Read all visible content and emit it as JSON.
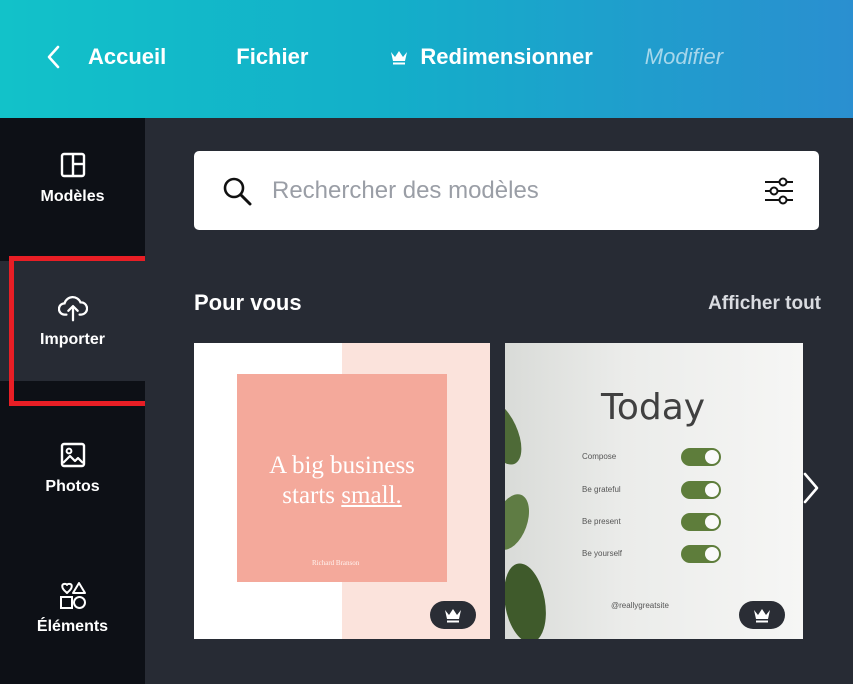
{
  "topbar": {
    "back_label": "Accueil",
    "file_label": "Fichier",
    "resize_label": "Redimensionner",
    "edit_label": "Modifier"
  },
  "rail": {
    "items": [
      {
        "label": "Modèles",
        "icon": "layout-icon"
      },
      {
        "label": "Importer",
        "icon": "cloud-upload-icon"
      },
      {
        "label": "Photos",
        "icon": "image-icon"
      },
      {
        "label": "Éléments",
        "icon": "shapes-icon"
      }
    ],
    "highlight_color": "#e81e25"
  },
  "search": {
    "placeholder": "Rechercher des modèles",
    "icon": "search-icon",
    "filter_icon": "sliders-icon"
  },
  "section": {
    "title": "Pour vous",
    "see_all": "Afficher tout"
  },
  "cards": [
    {
      "quote_line1": "A big business",
      "quote_line2_pre": "starts ",
      "quote_line2_u": "small.",
      "author": "Richard Branson",
      "badge": "crown-icon",
      "colors": {
        "pink": "#f4a99b",
        "tint": "#fbe3dc"
      }
    },
    {
      "title": "Today",
      "items": [
        "Compose",
        "Be grateful",
        "Be present",
        "Be yourself"
      ],
      "handle": "@reallygreatsite",
      "badge": "crown-icon",
      "toggle_color": "#5e7d3b"
    }
  ],
  "colors": {
    "topbar_start": "#12c2c9",
    "topbar_end": "#2a8fd0",
    "rail_bg": "#0d1016",
    "panel_bg": "#272b34"
  }
}
